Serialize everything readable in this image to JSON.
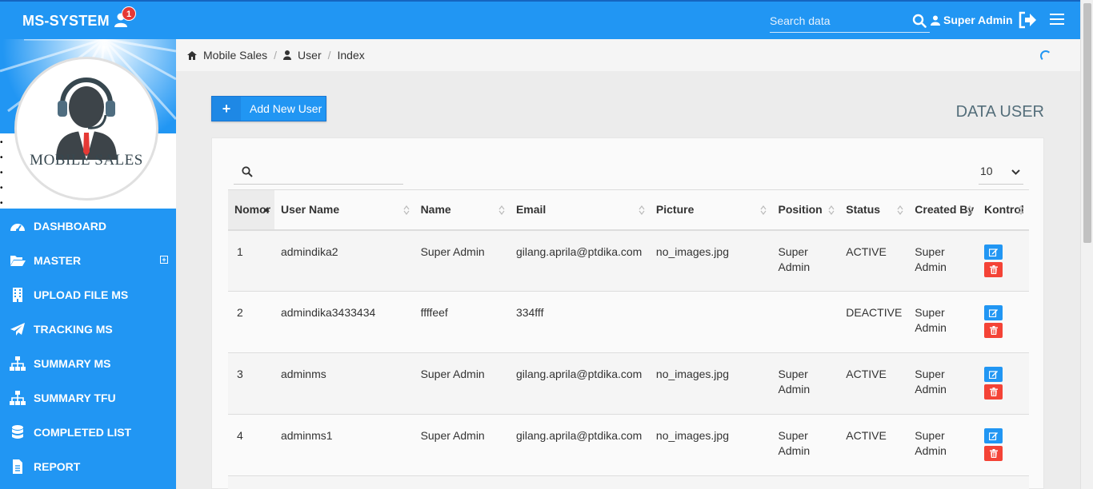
{
  "app": {
    "brand": "MS-SYSTEM",
    "notification_count": "1",
    "user": "Super Admin"
  },
  "search": {
    "placeholder": "Search data"
  },
  "profile": {
    "label": "MOBILE SALES"
  },
  "sidebar": {
    "items": [
      {
        "label": "DASHBOARD",
        "icon": "dashboard-icon"
      },
      {
        "label": "MASTER",
        "icon": "folder-open-icon",
        "expand": "+"
      },
      {
        "label": "UPLOAD FILE MS",
        "icon": "building-icon"
      },
      {
        "label": "TRACKING MS",
        "icon": "paper-plane-icon"
      },
      {
        "label": "SUMMARY MS",
        "icon": "sitemap-icon"
      },
      {
        "label": "SUMMARY TFU",
        "icon": "sitemap-icon"
      },
      {
        "label": "COMPLETED LIST",
        "icon": "database-icon"
      },
      {
        "label": "REPORT",
        "icon": "file-text-icon"
      }
    ]
  },
  "breadcrumb": {
    "home": "Mobile Sales",
    "section": "User",
    "page": "Index"
  },
  "main": {
    "add_button": "Add New User",
    "add_button_icon": "+",
    "title": "DATA USER"
  },
  "table": {
    "page_length": "10",
    "columns": [
      "Nomor",
      "User Name",
      "Name",
      "Email",
      "Picture",
      "Position",
      "Status",
      "Created By",
      "Kontrol"
    ],
    "rows": [
      [
        "1",
        "admindika2",
        "Super Admin",
        "gilang.aprila@ptdika.com",
        "no_images.jpg",
        "Super Admin",
        "ACTIVE",
        "Super Admin"
      ],
      [
        "2",
        "admindika3433434",
        "ffffeef",
        "334fff",
        "",
        "",
        "DEACTIVE",
        "Super Admin"
      ],
      [
        "3",
        "adminms",
        "Super Admin",
        "gilang.aprila@ptdika.com",
        "no_images.jpg",
        "Super Admin",
        "ACTIVE",
        "Super Admin"
      ],
      [
        "4",
        "adminms1",
        "Super Admin",
        "gilang.aprila@ptdika.com",
        "no_images.jpg",
        "Super Admin",
        "ACTIVE",
        "Super Admin"
      ]
    ]
  },
  "colors": {
    "primary": "#2196f3",
    "danger": "#f44336"
  }
}
